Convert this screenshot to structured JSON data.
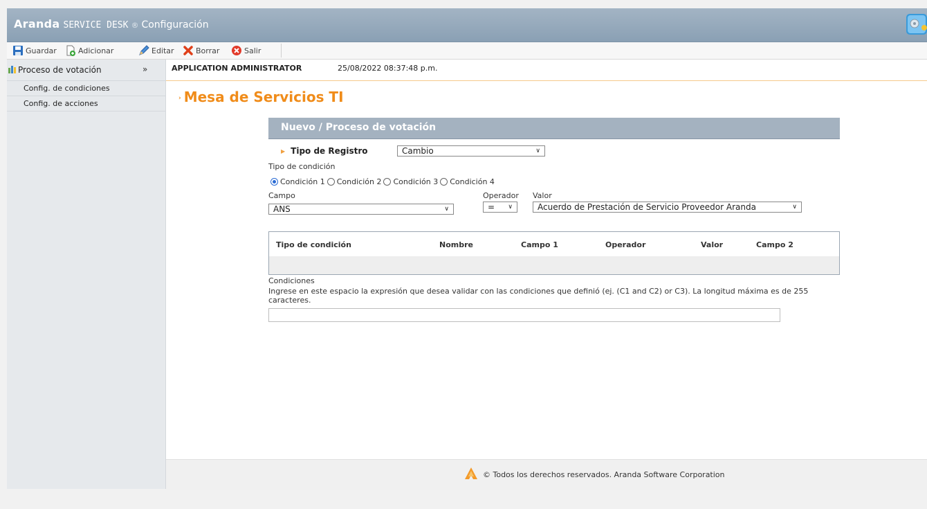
{
  "titlebar": {
    "brand": "Aranda",
    "product": "SERVICE DESK",
    "registered": "®",
    "module": "Configuración"
  },
  "toolbar": {
    "guardar": "Guardar",
    "adicionar": "Adicionar",
    "editar": "Editar",
    "borrar": "Borrar",
    "salir": "Salir"
  },
  "sidebar": {
    "header": "Proceso de votación",
    "items": [
      {
        "label": "Config. de condiciones"
      },
      {
        "label": "Config. de acciones"
      }
    ]
  },
  "userbar": {
    "user": "APPLICATION ADMINISTRATOR",
    "datetime": "25/08/2022 08:37:48 p.m."
  },
  "page": {
    "title": "Mesa de Servicios TI",
    "form_title": "Nuevo / Proceso de votación"
  },
  "form": {
    "tipo_registro_label": "Tipo de Registro",
    "tipo_registro_value": "Cambio",
    "tipo_condicion_label": "Tipo de condición",
    "condiciones": [
      {
        "label": "Condición 1",
        "checked": true
      },
      {
        "label": "Condición 2",
        "checked": false
      },
      {
        "label": "Condición 3",
        "checked": false
      },
      {
        "label": "Condición 4",
        "checked": false
      }
    ],
    "campo_label": "Campo",
    "campo_value": "ANS",
    "operador_label": "Operador",
    "operador_value": "=",
    "valor_label": "Valor",
    "valor_value": "Acuerdo de Prestación de Servicio Proveedor Aranda"
  },
  "table": {
    "columns": [
      "Tipo de condición",
      "Nombre",
      "Campo 1",
      "Operador",
      "Valor",
      "Campo 2"
    ],
    "rows": []
  },
  "conditions": {
    "title": "Condiciones",
    "help": "Ingrese en este espacio la expresión que desea validar con las condiciones que definió (ej. (C1 and C2) or C3). La longitud máxima es de 255 caracteres.",
    "value": ""
  },
  "footer": {
    "text": "© Todos los derechos reservados. Aranda Software Corporation"
  },
  "colors": {
    "accent_orange": "#f08c1a",
    "header_blue": "#a4b2c0",
    "radio_blue": "#2a6bd4"
  }
}
